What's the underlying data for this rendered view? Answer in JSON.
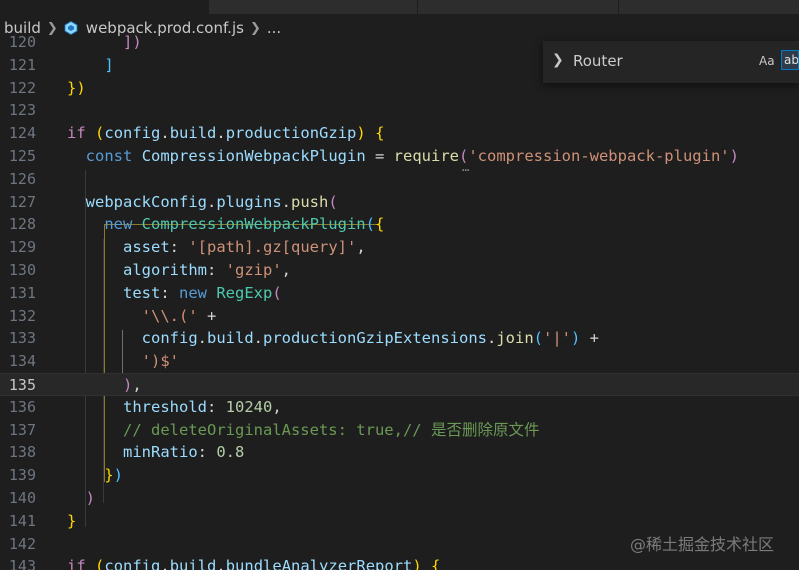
{
  "breadcrumb": {
    "folder": "build",
    "file": "webpack.prod.conf.js",
    "more": "..."
  },
  "find": {
    "query": "Router",
    "match_case_label": "Aa",
    "whole_word_label": "ab"
  },
  "watermark": "@稀土掘金技术社区",
  "current_line": "135",
  "lines": [
    {
      "n": "120",
      "tokens": [
        [
          "      ",
          ""
        ],
        [
          "])",
          "bp"
        ]
      ]
    },
    {
      "n": "121",
      "tokens": [
        [
          "    ",
          ""
        ],
        [
          "]",
          "bb"
        ]
      ]
    },
    {
      "n": "122",
      "tokens": [
        [
          "",
          ""
        ],
        [
          "})",
          "by"
        ]
      ]
    },
    {
      "n": "123",
      "tokens": []
    },
    {
      "n": "124",
      "tokens": [
        [
          "if",
          "tk-kw"
        ],
        [
          " ",
          ""
        ],
        [
          "(",
          "by"
        ],
        [
          "config",
          "tk-prop"
        ],
        [
          ".",
          "tk-punc"
        ],
        [
          "build",
          "tk-prop"
        ],
        [
          ".",
          "tk-punc"
        ],
        [
          "productionGzip",
          "tk-prop"
        ],
        [
          ")",
          "by"
        ],
        [
          " ",
          ""
        ],
        [
          "{",
          "by"
        ]
      ]
    },
    {
      "n": "125",
      "tokens": [
        [
          "  ",
          ""
        ],
        [
          "const",
          "tk-blue"
        ],
        [
          " ",
          ""
        ],
        [
          "CompressionWebpackPlugin",
          "tk-prop"
        ],
        [
          " = ",
          "tk-op"
        ],
        [
          "require",
          "tk-fn"
        ],
        [
          "(",
          "bp"
        ],
        [
          "'compression-webpack-plugin'",
          "tk-str"
        ],
        [
          ")",
          "bp"
        ]
      ]
    },
    {
      "n": "126",
      "tokens": []
    },
    {
      "n": "127",
      "tokens": [
        [
          "  ",
          ""
        ],
        [
          "webpackConfig",
          "tk-prop"
        ],
        [
          ".",
          "tk-punc"
        ],
        [
          "plugins",
          "tk-prop"
        ],
        [
          ".",
          "tk-punc"
        ],
        [
          "push",
          "tk-fn"
        ],
        [
          "(",
          "bp"
        ]
      ]
    },
    {
      "n": "128",
      "tokens": [
        [
          "    ",
          ""
        ],
        [
          "new",
          "tk-blue"
        ],
        [
          " ",
          ""
        ],
        [
          "CompressionWebpackPlugin",
          "tk-cls"
        ],
        [
          "(",
          "bb"
        ],
        [
          "{",
          "by"
        ]
      ]
    },
    {
      "n": "129",
      "tokens": [
        [
          "      ",
          ""
        ],
        [
          "asset",
          "tk-prop"
        ],
        [
          ": ",
          "tk-punc"
        ],
        [
          "'[path].gz[query]'",
          "tk-str"
        ],
        [
          ",",
          "tk-punc"
        ]
      ]
    },
    {
      "n": "130",
      "tokens": [
        [
          "      ",
          ""
        ],
        [
          "algorithm",
          "tk-prop"
        ],
        [
          ": ",
          "tk-punc"
        ],
        [
          "'gzip'",
          "tk-str"
        ],
        [
          ",",
          "tk-punc"
        ]
      ]
    },
    {
      "n": "131",
      "tokens": [
        [
          "      ",
          ""
        ],
        [
          "test",
          "tk-prop"
        ],
        [
          ": ",
          "tk-punc"
        ],
        [
          "new",
          "tk-blue"
        ],
        [
          " ",
          ""
        ],
        [
          "RegExp",
          "tk-cls"
        ],
        [
          "(",
          "bp"
        ]
      ]
    },
    {
      "n": "132",
      "tokens": [
        [
          "        ",
          ""
        ],
        [
          "'\\\\.('",
          "tk-str"
        ],
        [
          " +",
          "tk-op"
        ]
      ]
    },
    {
      "n": "133",
      "tokens": [
        [
          "        ",
          ""
        ],
        [
          "config",
          "tk-prop"
        ],
        [
          ".",
          "tk-punc"
        ],
        [
          "build",
          "tk-prop"
        ],
        [
          ".",
          "tk-punc"
        ],
        [
          "productionGzipExtensions",
          "tk-prop"
        ],
        [
          ".",
          "tk-punc"
        ],
        [
          "join",
          "tk-fn"
        ],
        [
          "(",
          "bb"
        ],
        [
          "'|'",
          "tk-str"
        ],
        [
          ")",
          "bb"
        ],
        [
          " +",
          "tk-op"
        ]
      ]
    },
    {
      "n": "134",
      "tokens": [
        [
          "        ",
          ""
        ],
        [
          "')$'",
          "tk-str"
        ]
      ]
    },
    {
      "n": "135",
      "tokens": [
        [
          "      ",
          ""
        ],
        [
          ")",
          "bp"
        ],
        [
          ",",
          "tk-punc"
        ]
      ]
    },
    {
      "n": "136",
      "tokens": [
        [
          "      ",
          ""
        ],
        [
          "threshold",
          "tk-prop"
        ],
        [
          ": ",
          "tk-punc"
        ],
        [
          "10240",
          "tk-num"
        ],
        [
          ",",
          "tk-punc"
        ]
      ]
    },
    {
      "n": "137",
      "tokens": [
        [
          "      ",
          ""
        ],
        [
          "// deleteOriginalAssets: true,// 是否删除原文件",
          "tk-cm"
        ]
      ]
    },
    {
      "n": "138",
      "tokens": [
        [
          "      ",
          ""
        ],
        [
          "minRatio",
          "tk-prop"
        ],
        [
          ": ",
          "tk-punc"
        ],
        [
          "0.8",
          "tk-num"
        ]
      ]
    },
    {
      "n": "139",
      "tokens": [
        [
          "    ",
          ""
        ],
        [
          "}",
          "by"
        ],
        [
          ")",
          "bb"
        ]
      ]
    },
    {
      "n": "140",
      "tokens": [
        [
          "  ",
          ""
        ],
        [
          ")",
          "bp"
        ]
      ]
    },
    {
      "n": "141",
      "tokens": [
        [
          "",
          ""
        ],
        [
          "}",
          "by"
        ]
      ]
    },
    {
      "n": "142",
      "tokens": []
    },
    {
      "n": "143",
      "tokens": [
        [
          "if",
          "tk-kw"
        ],
        [
          " ",
          ""
        ],
        [
          "(",
          "by"
        ],
        [
          "config",
          "tk-prop"
        ],
        [
          ".",
          "tk-punc"
        ],
        [
          "build",
          "tk-prop"
        ],
        [
          ".",
          "tk-punc"
        ],
        [
          "bundleAnalyzerReport",
          "tk-prop"
        ],
        [
          ")",
          "by"
        ],
        [
          " ",
          ""
        ],
        [
          "{",
          "by"
        ]
      ]
    }
  ]
}
